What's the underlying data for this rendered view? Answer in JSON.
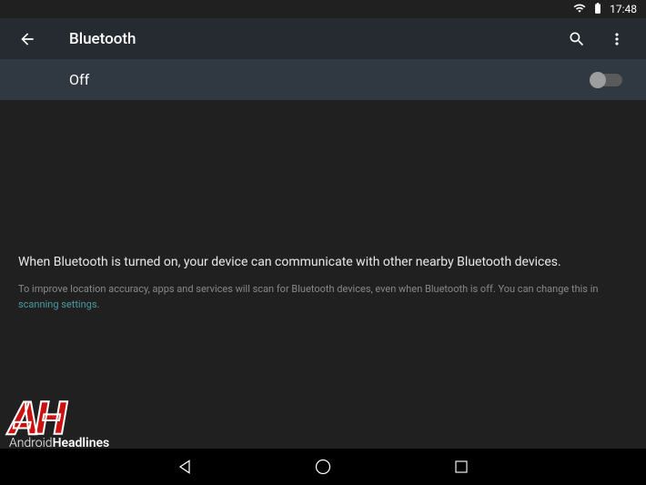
{
  "status": {
    "time": "17:48"
  },
  "appbar": {
    "title": "Bluetooth"
  },
  "toggle": {
    "label": "Off"
  },
  "content": {
    "main": "When Bluetooth is turned on, your device can communicate with other nearby Bluetooth devices.",
    "sub_prefix": "To improve location accuracy, apps and services will scan for Bluetooth devices, even when Bluetooth is off. You can change this in ",
    "link": "scanning settings",
    "sub_suffix": "."
  },
  "watermark": {
    "logo": "AH",
    "text_prefix": "Android",
    "text_bold": "Headlines"
  }
}
